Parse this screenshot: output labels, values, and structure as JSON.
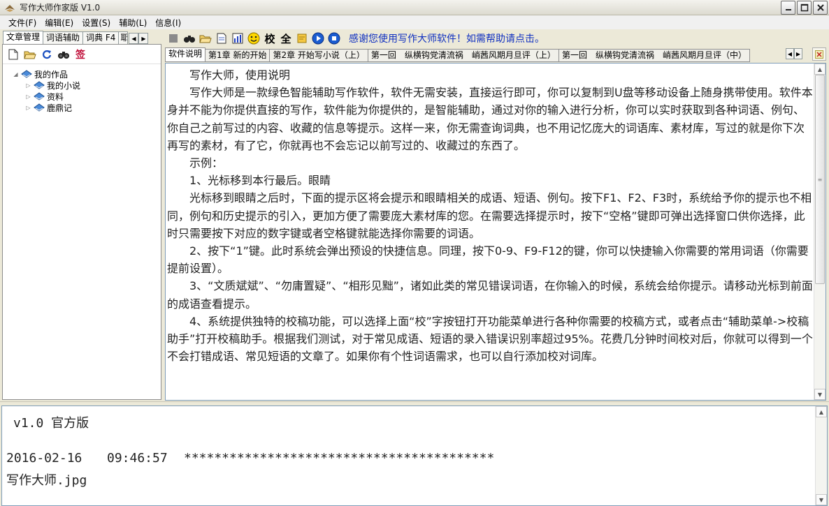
{
  "window": {
    "title": "写作大师作家版  V1.0"
  },
  "menu": [
    {
      "label": "文件(F)"
    },
    {
      "label": "编辑(E)"
    },
    {
      "label": "设置(S)"
    },
    {
      "label": "辅助(L)"
    },
    {
      "label": "信息(I)"
    }
  ],
  "left_tabs": [
    {
      "label": "文章管理",
      "active": true
    },
    {
      "label": "词语辅助"
    },
    {
      "label": "词典 F4"
    },
    {
      "label": "耶"
    }
  ],
  "left_toolbar": {
    "sign_label": "签"
  },
  "tree": {
    "root": "我的作品",
    "children": [
      "我的小说",
      "资料",
      "鹿鼎记"
    ]
  },
  "toolbar": {
    "proof_label": "校",
    "all_label": "全",
    "thanks_link": "感谢您使用写作大师软件！如需帮助请点击。"
  },
  "doc_tabs": [
    {
      "label": "软件说明",
      "active": true
    },
    {
      "label": "第1章 新的开始"
    },
    {
      "label": "第2章 开始写小说（上）"
    },
    {
      "label": "第一回　纵横钩党清流祸　峭茜风期月旦评（上）"
    },
    {
      "label": "第一回　纵横钩党清流祸　峭茜风期月旦评（中）"
    }
  ],
  "editor": {
    "paragraphs": [
      "写作大师，使用说明",
      "写作大师是一款绿色智能辅助写作软件，软件无需安装，直接运行即可，你可以复制到U盘等移动设备上随身携带使用。软件本身并不能为你提供直接的写作，软件能为你提供的，是智能辅助，通过对你的输入进行分析，你可以实时获取到各种词语、例句、你自己之前写过的内容、收藏的信息等提示。这样一来，你无需查询词典，也不用记忆庞大的词语库、素材库，写过的就是你下次再写的素材，有了它，你就再也不会忘记以前写过的、收藏过的东西了。",
      "示例：",
      "1、光标移到本行最后。眼睛",
      "光标移到眼睛之后时，下面的提示区将会提示和眼睛相关的成语、短语、例句。按下F1、F2、F3时，系统给予你的提示也不相同，例句和历史提示的引入，更加方便了需要庞大素材库的您。在需要选择提示时，按下“空格”键即可弹出选择窗口供你选择，此时只需要按下对应的数字键或者空格键就能选择你需要的词语。",
      "2、按下“1”键。此时系统会弹出预设的快捷信息。同理，按下0-9、F9-F12的键，你可以快捷输入你需要的常用词语（你需要提前设置）。",
      "3、“文质斌斌”、“勿庸置疑”、“相形见黜”，诸如此类的常见错误词语，在你输入的时候，系统会给你提示。请移动光标到前面的成语查看提示。",
      "4、系统提供独特的校稿功能，可以选择上面“校”字按钮打开功能菜单进行各种你需要的校稿方式，或者点击“辅助菜单->校稿助手”打开校稿助手。根据我们测试，对于常见成语、短语的录入错误识别率超过95%。花费几分钟时间校对后，你就可以得到一个不会打错成语、常见短语的文章了。如果你有个性词语需求，也可以自行添加校对词库。"
    ]
  },
  "bottom": {
    "version": "v1.0 官方版",
    "date": "2016-02-16",
    "time": "09:46:57",
    "stars": "*****************************************",
    "file": "写作大师.jpg"
  }
}
